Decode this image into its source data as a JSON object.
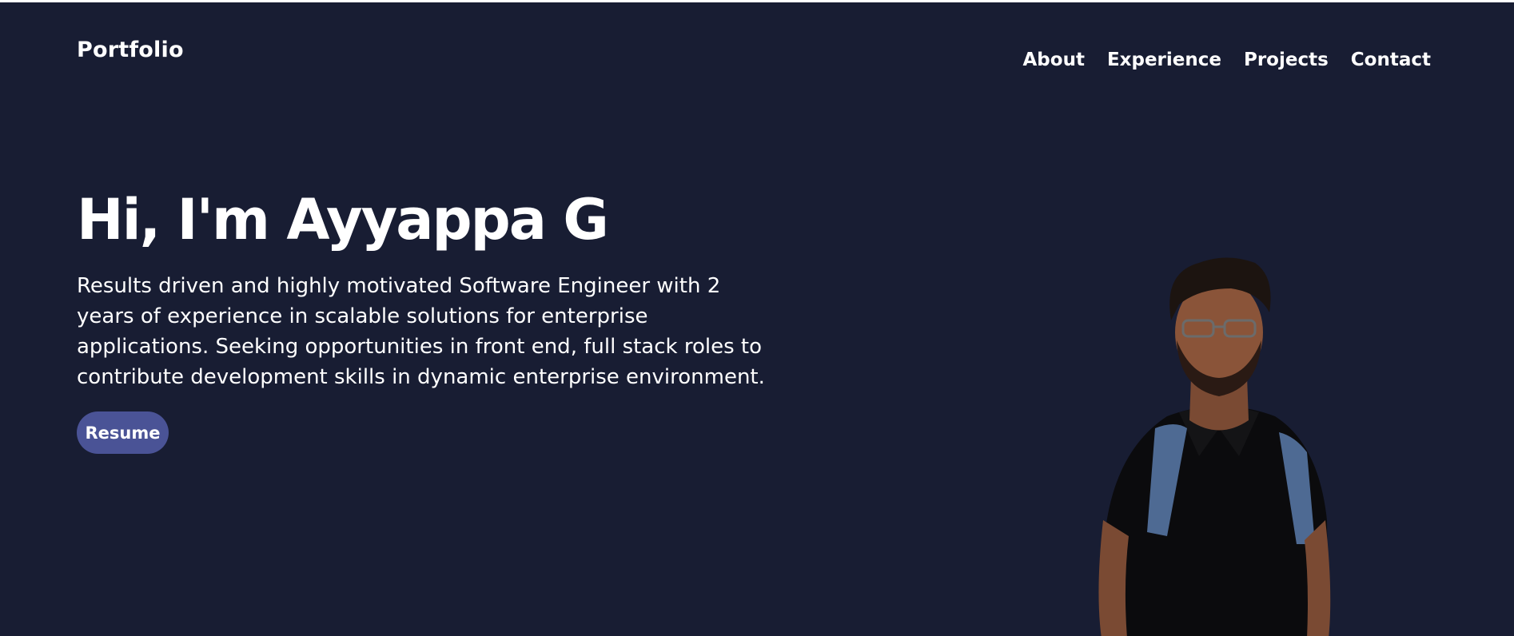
{
  "header": {
    "brand": "Portfolio",
    "nav": [
      {
        "label": "About"
      },
      {
        "label": "Experience"
      },
      {
        "label": "Projects"
      },
      {
        "label": "Contact"
      }
    ]
  },
  "hero": {
    "title": "Hi, I'm Ayyappa G",
    "description": "Results driven and highly motivated Software Engineer with 2 years of experience in scalable solutions for enterprise applications. Seeking opportunities in front end, full stack roles to contribute development skills in dynamic enterprise environment.",
    "resume_label": "Resume"
  },
  "colors": {
    "background": "#181d33",
    "button": "#4a5396",
    "text": "#ffffff"
  }
}
